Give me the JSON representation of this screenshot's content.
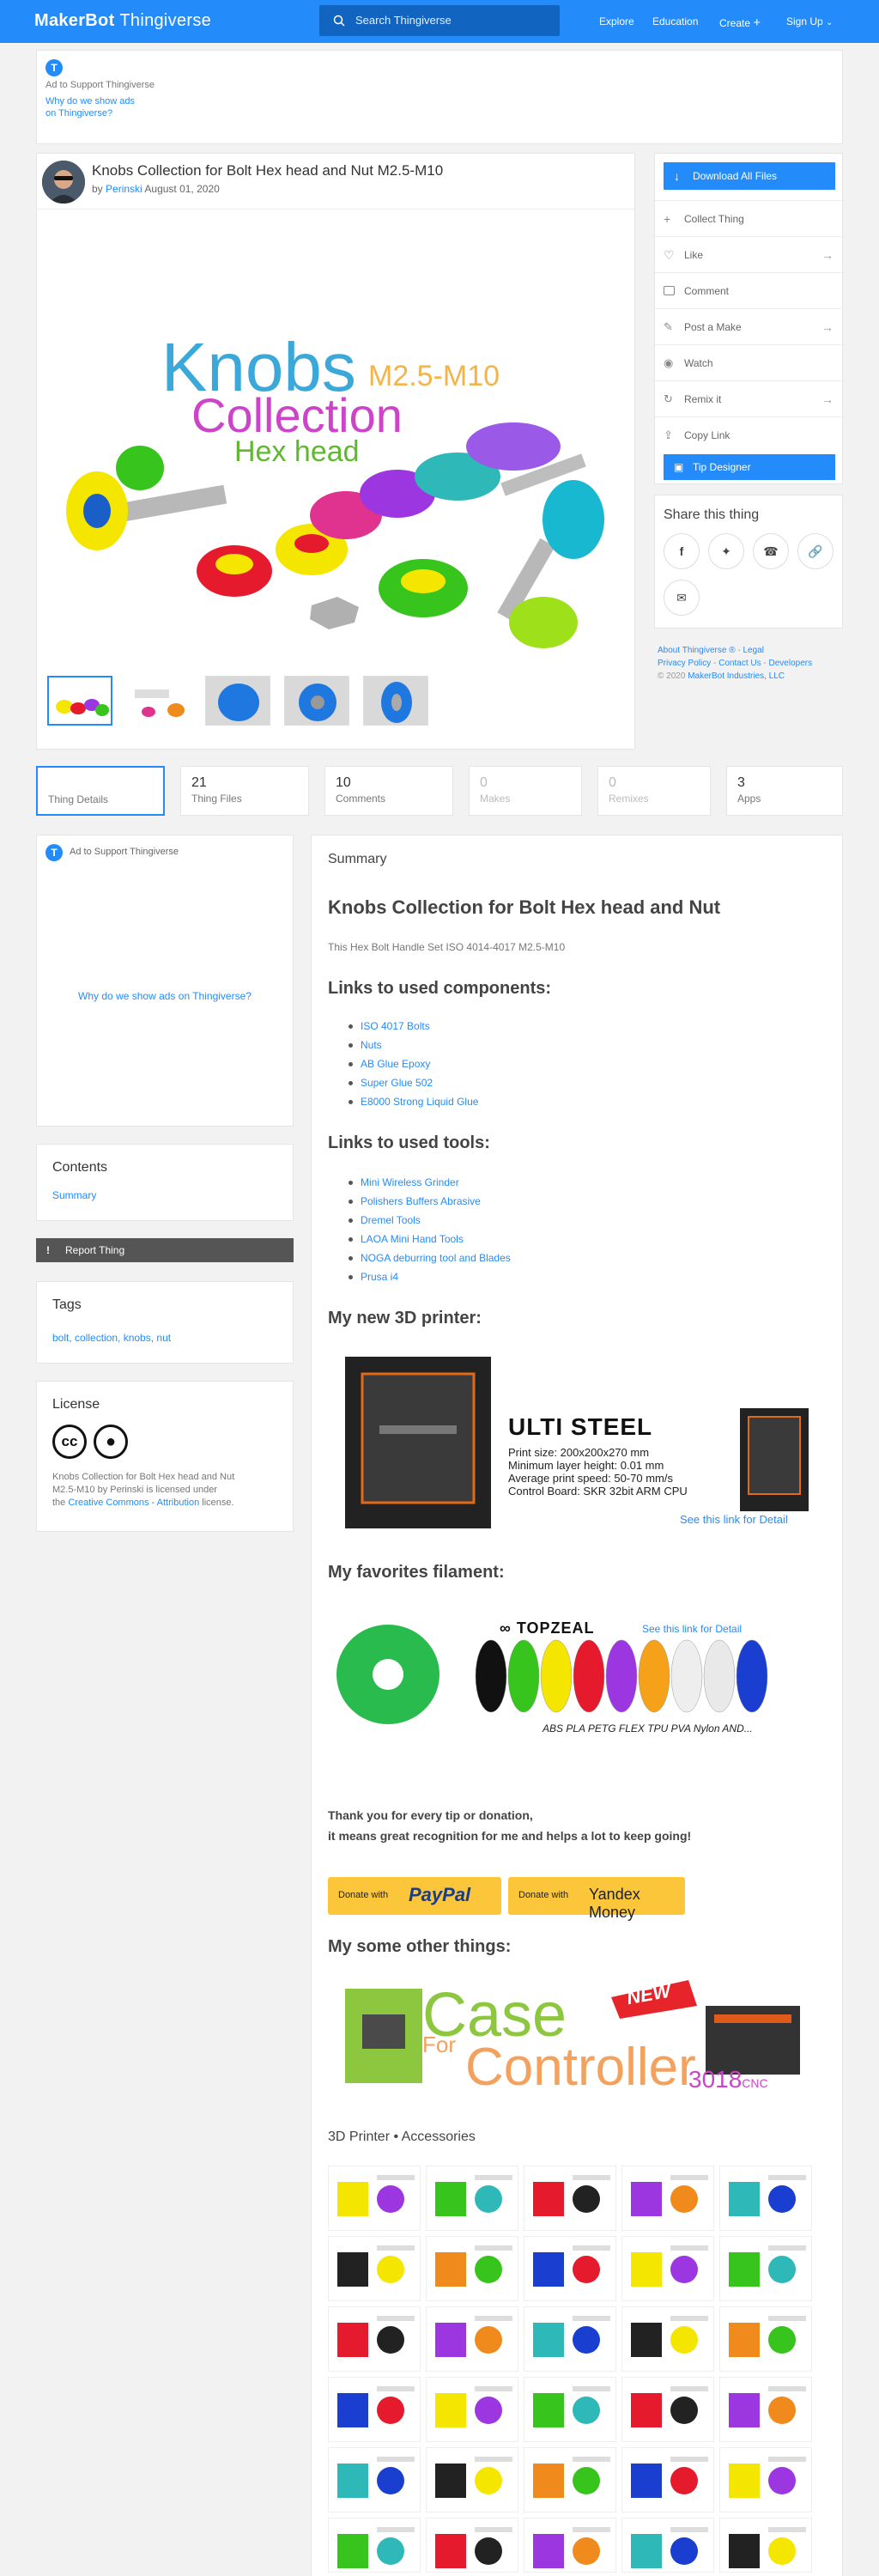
{
  "header": {
    "logo_brand": "MakerBot",
    "logo_product": "Thingiverse",
    "search_placeholder": "Search Thingiverse",
    "nav": [
      "Explore",
      "Education",
      "Create",
      "Sign Up"
    ]
  },
  "top_ad": {
    "text": "Ad to Support Thingiverse",
    "why_line1": "Why do we show ads",
    "why_line2": "on Thingiverse?"
  },
  "thing": {
    "title": "Knobs Collection for Bolt Hex head and Nut M2.5-M10",
    "by": "by",
    "author": "Perinski",
    "date": "August 01, 2020",
    "hero_text": {
      "line1": "Knobs",
      "line2": "M2.5-M10",
      "line3": "Collection",
      "line4": "Hex head"
    }
  },
  "actions": {
    "download": "Download All Files",
    "items": [
      "Collect Thing",
      "Like",
      "Comment",
      "Post a Make",
      "Watch",
      "Remix it",
      "Copy Link"
    ],
    "tip": "Tip Designer"
  },
  "share": {
    "title": "Share this thing"
  },
  "footer_links": {
    "line1": [
      "About Thingiverse ®",
      "Legal"
    ],
    "line2": [
      "Privacy Policy",
      "Contact Us",
      "Developers"
    ],
    "copyright": "© 2020",
    "company": "MakerBot Industries, LLC"
  },
  "tabs": [
    {
      "n": "",
      "label": "Thing Details"
    },
    {
      "n": "21",
      "label": "Thing Files"
    },
    {
      "n": "10",
      "label": "Comments"
    },
    {
      "n": "0",
      "label": "Makes"
    },
    {
      "n": "0",
      "label": "Remixes"
    },
    {
      "n": "3",
      "label": "Apps"
    }
  ],
  "left": {
    "ad_text": "Ad to Support Thingiverse",
    "ad_why": "Why do we show ads on Thingiverse?",
    "contents_title": "Contents",
    "contents_item": "Summary",
    "report": "Report Thing",
    "tags_title": "Tags",
    "tags": "bolt, collection, knobs, nut",
    "license_title": "License",
    "license_text1": "Knobs Collection for Bolt Hex head and Nut",
    "license_text2": "M2.5-M10 by Perinski is licensed under",
    "license_text3": "the",
    "license_link": "Creative Commons - Attribution",
    "license_text4": "license."
  },
  "summary": {
    "label": "Summary",
    "heading": "Knobs Collection for Bolt Hex head and Nut",
    "subtitle": "This Hex Bolt Handle Set ISO 4014-4017 M2.5-M10",
    "components_heading": "Links to used components:",
    "components": [
      "ISO 4017 Bolts",
      "Nuts",
      "AB Glue Epoxy",
      "Super Glue 502",
      "E8000 Strong Liquid Glue"
    ],
    "tools_heading": "Links to used tools:",
    "tools": [
      "Mini Wireless Grinder",
      "Polishers Buffers Abrasive",
      "Dremel Tools",
      "LAOA Mini Hand Tools",
      "NOGA deburring tool and Blades",
      "Prusa i4"
    ],
    "printer_heading": "My new 3D printer:",
    "printer": {
      "name": "ULTI STEEL",
      "spec1": "Print size: 200x200x270 mm",
      "spec2": "Minimum layer height: 0.01 mm",
      "spec3": "Average print speed: 50-70 mm/s",
      "spec4": "Control Board: SKR 32bit ARM CPU",
      "link": "See this link for Detail"
    },
    "filament_heading": "My favorites filament:",
    "filament": {
      "brand": "TOPZEAL",
      "link": "See this link for Detail",
      "types": "ABS PLA PETG FLEX TPU PVA Nylon AND..."
    },
    "thanks1": "Thank you for every tip or donation,",
    "thanks2": "it means great recognition for me and helps a lot to keep going!",
    "paypal_pre": "Donate with",
    "paypal": "PayPal",
    "yandex_pre": "Donate with",
    "yandex": "Yandex Money",
    "other_heading": "My some other things:",
    "banner": {
      "case": "Case",
      "for": "For",
      "controller": "Controller",
      "new": "NEW",
      "model": "3018",
      "cnc": "CNC"
    },
    "accessories_heading": "3D Printer • Accessories"
  },
  "colors": {
    "brand_blue": "#248bfb",
    "knob_colors": [
      "#f5e600",
      "#37c41c",
      "#e51a2c",
      "#e0338f",
      "#9b36e0",
      "#2fb8b8",
      "#18b8d0"
    ]
  }
}
